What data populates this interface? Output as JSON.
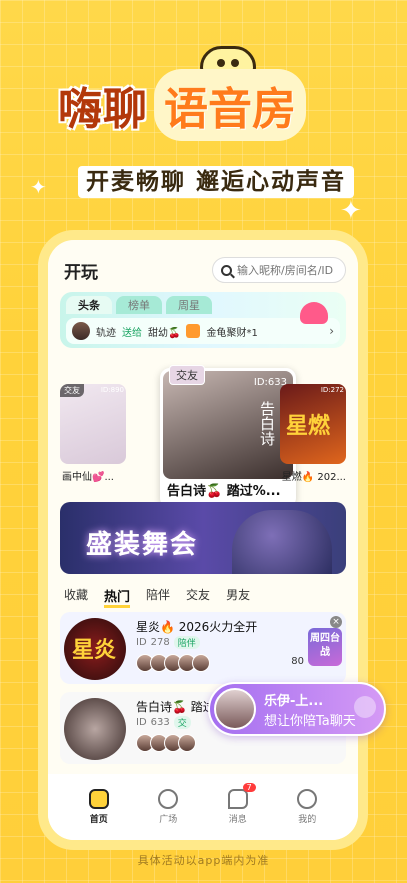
{
  "poster": {
    "title_left": "嗨聊",
    "title_right": "语音房",
    "subtitle": "开麦畅聊 邂逅心动声音",
    "footer": "具体活动以app端内为准"
  },
  "app": {
    "name": "开玩",
    "search_placeholder": "输入昵称/房间名/ID"
  },
  "tabs": [
    "头条",
    "榜单",
    "周星"
  ],
  "ticker": {
    "user": "轨迹",
    "action": "送给",
    "target": "甜幼🍒",
    "gift": "金龟聚财*1"
  },
  "rooms": {
    "left": {
      "tag": "交友",
      "id": "ID:890",
      "caption": "画中仙💕..."
    },
    "center": {
      "tag": "交友",
      "id": "ID:633",
      "vertical": "告白诗",
      "title": "告白诗🍒 踏过%..."
    },
    "right": {
      "tag": "",
      "id": "ID:272",
      "big": "星燃",
      "caption": "星燃🔥 202..."
    }
  },
  "banner": {
    "text": "盛装舞会"
  },
  "categories": [
    "收藏",
    "热门",
    "陪伴",
    "交友",
    "男友"
  ],
  "list": [
    {
      "thumb": "星炎",
      "title": "星炎🔥 2026火力全开",
      "id": "ID",
      "id_val": "278",
      "badge": "陪伴",
      "count": "80",
      "side": "周四台战"
    },
    {
      "title": "告白诗🍒 踏过",
      "id": "ID",
      "id_val": "633",
      "badge": "交"
    }
  ],
  "call": {
    "name": "乐伊-上...",
    "message": "想让你陪Ta聊天"
  },
  "tabbar": [
    {
      "label": "首页",
      "icon": "home-icon"
    },
    {
      "label": "广场",
      "icon": "planet-icon"
    },
    {
      "label": "消息",
      "icon": "message-icon",
      "badge": "7"
    },
    {
      "label": "我的",
      "icon": "profile-icon"
    }
  ]
}
